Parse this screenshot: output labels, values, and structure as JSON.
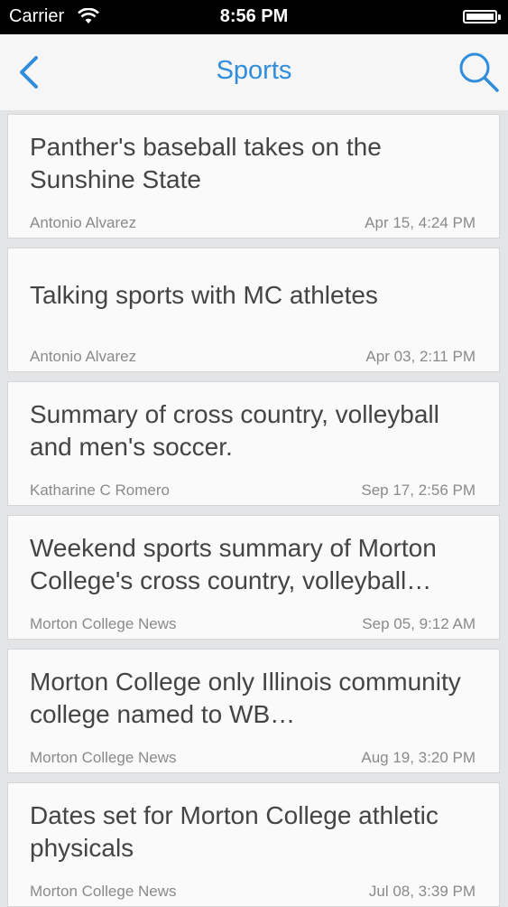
{
  "status_bar": {
    "carrier": "Carrier",
    "time": "8:56 PM"
  },
  "nav": {
    "title": "Sports",
    "accent_color": "#2f8ddb"
  },
  "articles": [
    {
      "headline": "Panther's baseball takes on the Sunshine State",
      "author": "Antonio Alvarez",
      "date": "Apr 15, 4:24 PM"
    },
    {
      "headline": "Talking sports with MC athletes",
      "author": "Antonio Alvarez",
      "date": "Apr 03, 2:11 PM"
    },
    {
      "headline": "Summary of cross country, volleyball and men's soccer.",
      "author": "Katharine C Romero",
      "date": "Sep 17, 2:56 PM"
    },
    {
      "headline": "Weekend sports summary of Morton College's cross country, volleyball…",
      "author": "Morton College News",
      "date": "Sep 05, 9:12 AM"
    },
    {
      "headline": "Morton College only Illinois community college named to WB…",
      "author": "Morton College News",
      "date": "Aug 19, 3:20 PM"
    },
    {
      "headline": "Dates set for Morton College athletic physicals",
      "author": "Morton College News",
      "date": "Jul 08, 3:39 PM"
    }
  ]
}
